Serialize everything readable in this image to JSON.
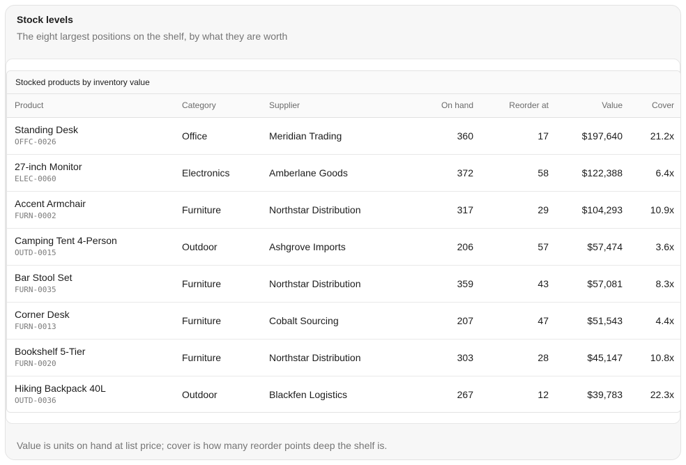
{
  "header": {
    "title": "Stock levels",
    "subtitle": "The eight largest positions on the shelf, by what they are worth"
  },
  "table": {
    "caption": "Stocked products by inventory value",
    "columns": {
      "product": "Product",
      "category": "Category",
      "supplier": "Supplier",
      "on_hand": "On hand",
      "reorder_at": "Reorder at",
      "value": "Value",
      "cover": "Cover"
    },
    "rows": [
      {
        "name": "Standing Desk",
        "sku": "OFFC-0026",
        "category": "Office",
        "supplier": "Meridian Trading",
        "on_hand": "360",
        "reorder_at": "17",
        "value": "$197,640",
        "cover": "21.2x"
      },
      {
        "name": "27-inch Monitor",
        "sku": "ELEC-0060",
        "category": "Electronics",
        "supplier": "Amberlane Goods",
        "on_hand": "372",
        "reorder_at": "58",
        "value": "$122,388",
        "cover": "6.4x"
      },
      {
        "name": "Accent Armchair",
        "sku": "FURN-0002",
        "category": "Furniture",
        "supplier": "Northstar Distribution",
        "on_hand": "317",
        "reorder_at": "29",
        "value": "$104,293",
        "cover": "10.9x"
      },
      {
        "name": "Camping Tent 4-Person",
        "sku": "OUTD-0015",
        "category": "Outdoor",
        "supplier": "Ashgrove Imports",
        "on_hand": "206",
        "reorder_at": "57",
        "value": "$57,474",
        "cover": "3.6x"
      },
      {
        "name": "Bar Stool Set",
        "sku": "FURN-0035",
        "category": "Furniture",
        "supplier": "Northstar Distribution",
        "on_hand": "359",
        "reorder_at": "43",
        "value": "$57,081",
        "cover": "8.3x"
      },
      {
        "name": "Corner Desk",
        "sku": "FURN-0013",
        "category": "Furniture",
        "supplier": "Cobalt Sourcing",
        "on_hand": "207",
        "reorder_at": "47",
        "value": "$51,543",
        "cover": "4.4x"
      },
      {
        "name": "Bookshelf 5-Tier",
        "sku": "FURN-0020",
        "category": "Furniture",
        "supplier": "Northstar Distribution",
        "on_hand": "303",
        "reorder_at": "28",
        "value": "$45,147",
        "cover": "10.8x"
      },
      {
        "name": "Hiking Backpack 40L",
        "sku": "OUTD-0036",
        "category": "Outdoor",
        "supplier": "Blackfen Logistics",
        "on_hand": "267",
        "reorder_at": "12",
        "value": "$39,783",
        "cover": "22.3x"
      }
    ]
  },
  "footer": {
    "note": "Value is units on hand at list price; cover is how many reorder points deep the shelf is."
  }
}
